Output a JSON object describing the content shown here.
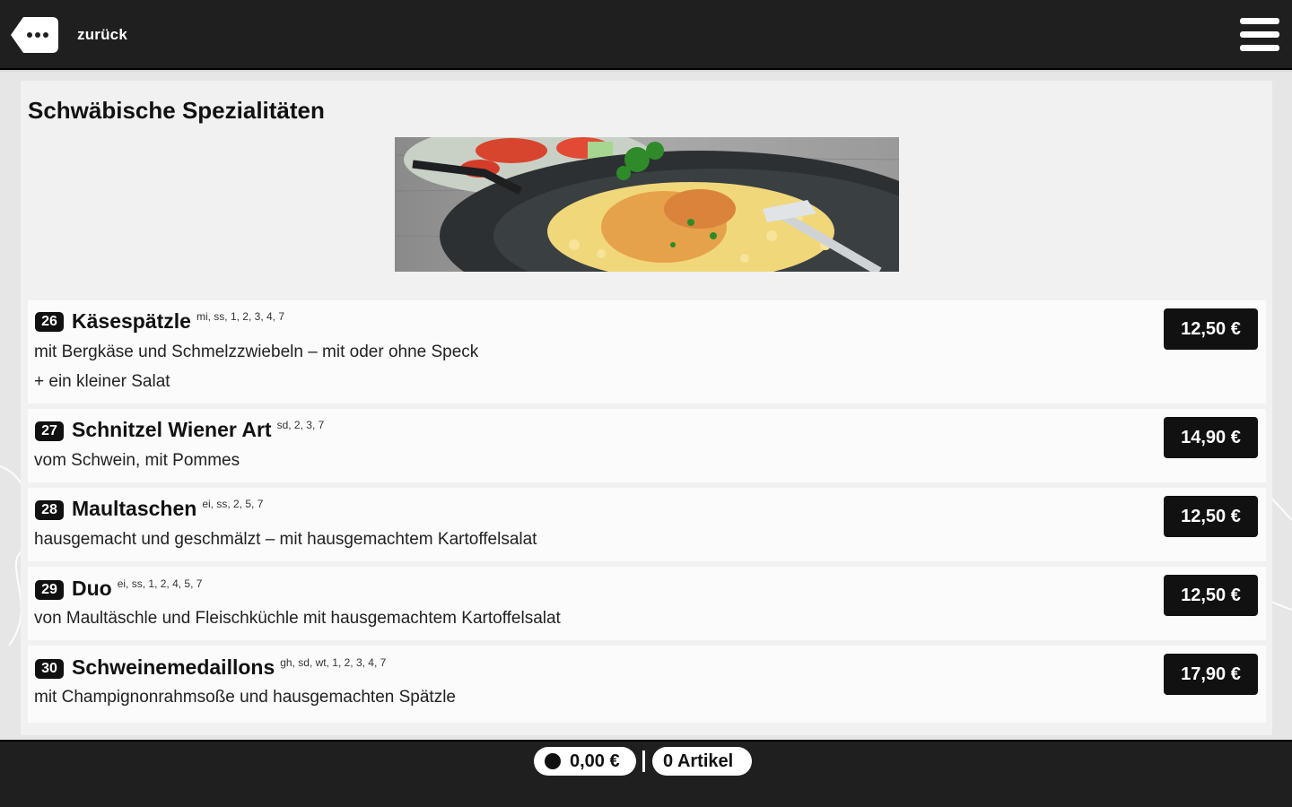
{
  "header": {
    "back_label": "zurück"
  },
  "section": {
    "title": "Schwäbische Spezialitäten"
  },
  "items": [
    {
      "number": "26",
      "name": "Käsespätzle",
      "allergens": "mi, ss, 1, 2, 3, 4, 7",
      "description_lines": [
        "mit Bergkäse und Schmelzzwiebeln – mit oder ohne Speck",
        "+ ein kleiner Salat"
      ],
      "price": "12,50 €"
    },
    {
      "number": "27",
      "name": "Schnitzel Wiener Art",
      "allergens": "sd, 2, 3, 7",
      "description_lines": [
        "vom Schwein, mit Pommes"
      ],
      "price": "14,90 €"
    },
    {
      "number": "28",
      "name": "Maultaschen",
      "allergens": "ei, ss, 2, 5, 7",
      "description_lines": [
        "hausgemacht und geschmälzt – mit hausgemachtem Kartoffelsalat"
      ],
      "price": "12,50 €"
    },
    {
      "number": "29",
      "name": "Duo",
      "allergens": "ei, ss, 1, 2, 4, 5, 7",
      "description_lines": [
        "von Maultäschle und Fleischküchle mit hausgemachtem Kartoffelsalat"
      ],
      "price": "12,50 €"
    },
    {
      "number": "30",
      "name": "Schweinemedaillons",
      "allergens": "gh, sd, wt, 1, 2, 3, 4, 7",
      "description_lines": [
        "mit Champignonrahmsoße und hausgemachten Spätzle"
      ],
      "price": "17,90 €"
    }
  ],
  "footer": {
    "cart_total": "0,00 €",
    "cart_count": "0 Artikel"
  },
  "colors": {
    "bar": "#1f1f1f",
    "price_button": "#111111",
    "panel": "#f1f1f1"
  },
  "icons": {
    "back": "back-tag-icon",
    "menu": "hamburger-menu-icon",
    "cart": "cart-icon"
  }
}
